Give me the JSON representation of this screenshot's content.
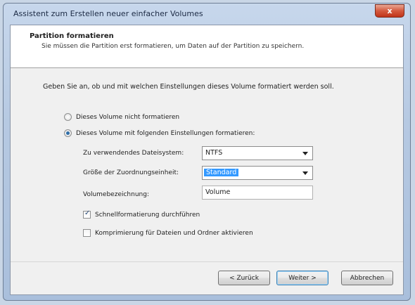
{
  "window": {
    "title": "Assistent zum Erstellen neuer einfacher Volumes"
  },
  "header": {
    "title": "Partition formatieren",
    "subtitle": "Sie müssen die Partition erst formatieren, um Daten auf der Partition zu speichern."
  },
  "intro": "Geben Sie an, ob und mit welchen Einstellungen dieses Volume formatiert werden soll.",
  "options": {
    "no_format": {
      "label": "Dieses Volume nicht formatieren",
      "checked": false
    },
    "format": {
      "label": "Dieses Volume mit folgenden Einstellungen formatieren:",
      "checked": true
    }
  },
  "settings": {
    "filesystem_label": "Zu verwendendes Dateisystem:",
    "filesystem_value": "NTFS",
    "allocation_label": "Größe der Zuordnungseinheit:",
    "allocation_value": "Standard",
    "volume_label_label": "Volumebezeichnung:",
    "volume_label_value": "Volume",
    "quick_format_label": "Schnellformatierung durchführen",
    "quick_format_checked": true,
    "compression_label": "Komprimierung für Dateien und Ordner aktivieren",
    "compression_checked": false
  },
  "buttons": {
    "back": "< Zurück",
    "next": "Weiter >",
    "cancel": "Abbrechen"
  },
  "titlebar": {
    "close_glyph": "x"
  },
  "colors": {
    "accent": "#3399ff",
    "close": "#c0341a"
  },
  "icons": {
    "close": "close-icon",
    "dropdown": "chevron-down-icon",
    "check": "checkmark-icon"
  }
}
